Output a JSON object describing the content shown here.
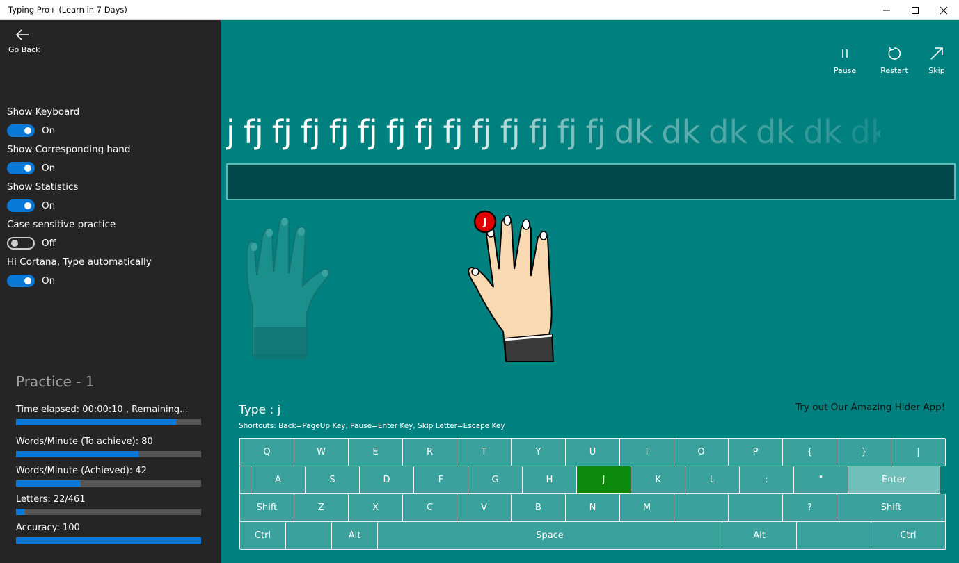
{
  "window": {
    "title": "Typing Pro+ (Learn in 7 Days)"
  },
  "sidebar": {
    "back_label": "Go Back",
    "settings": [
      {
        "label": "Show Keyboard",
        "on": true,
        "state": "On"
      },
      {
        "label": "Show Corresponding hand",
        "on": true,
        "state": "On"
      },
      {
        "label": "Show Statistics",
        "on": true,
        "state": "On"
      },
      {
        "label": "Case sensitive practice",
        "on": false,
        "state": "Off"
      },
      {
        "label": "Hi Cortana, Type automatically",
        "on": true,
        "state": "On"
      }
    ],
    "practice_title": "Practice - 1",
    "stats": [
      {
        "label": "Time elapsed: 00:00:10 , Remaining...",
        "progress": 0.87
      },
      {
        "label": "Words/Minute (To achieve): 80",
        "progress": 0.66
      },
      {
        "label": "Words/Minute (Achieved): 42",
        "progress": 0.35
      },
      {
        "label": "Letters: 22/461",
        "progress": 0.05
      },
      {
        "label": "Accuracy: 100",
        "progress": 1.0
      }
    ]
  },
  "actions": {
    "pause": "Pause",
    "restart": "Restart",
    "skip": "Skip"
  },
  "practice": {
    "words": [
      "j",
      "fj",
      "fj",
      "fj",
      "fj",
      "fj",
      "fj",
      "fj",
      "fj",
      "fj",
      "fj",
      "fj",
      "fj",
      "fj",
      "dk",
      "dk",
      "dk",
      "dk",
      "dk",
      "dk"
    ],
    "opacity": [
      1,
      1,
      1,
      1,
      1,
      1,
      1,
      1,
      0.9,
      0.8,
      0.7,
      0.6,
      0.5,
      0.45,
      0.4,
      0.35,
      0.3,
      0.25,
      0.2,
      0.12
    ]
  },
  "hand": {
    "finger_letter": "J"
  },
  "type_label": "Type : j",
  "shortcuts": "Shortcuts:  Back=PageUp Key,  Pause=Enter Key,  Skip Letter=Escape Key",
  "promo": "Try out Our Amazing Hider App!",
  "keyboard": {
    "active_key": "J",
    "rows": [
      [
        {
          "k": "Q",
          "w": 78
        },
        {
          "k": "W",
          "w": 78
        },
        {
          "k": "E",
          "w": 78
        },
        {
          "k": "R",
          "w": 78
        },
        {
          "k": "T",
          "w": 78
        },
        {
          "k": "Y",
          "w": 78
        },
        {
          "k": "U",
          "w": 78
        },
        {
          "k": "I",
          "w": 78
        },
        {
          "k": "O",
          "w": 78
        },
        {
          "k": "P",
          "w": 78
        },
        {
          "k": "{",
          "w": 78
        },
        {
          "k": "}",
          "w": 78
        },
        {
          "k": "|",
          "w": 78
        }
      ],
      [
        {
          "k": "",
          "w": 16
        },
        {
          "k": "A",
          "w": 78
        },
        {
          "k": "S",
          "w": 78
        },
        {
          "k": "D",
          "w": 78
        },
        {
          "k": "F",
          "w": 78
        },
        {
          "k": "G",
          "w": 78
        },
        {
          "k": "H",
          "w": 78
        },
        {
          "k": "J",
          "w": 78
        },
        {
          "k": "K",
          "w": 78
        },
        {
          "k": "L",
          "w": 78
        },
        {
          "k": ":",
          "w": 78
        },
        {
          "k": "\"",
          "w": 78
        },
        {
          "k": "Enter",
          "w": 132
        }
      ],
      [
        {
          "k": "Shift",
          "w": 78
        },
        {
          "k": "Z",
          "w": 78
        },
        {
          "k": "X",
          "w": 78
        },
        {
          "k": "C",
          "w": 78
        },
        {
          "k": "V",
          "w": 78
        },
        {
          "k": "B",
          "w": 78
        },
        {
          "k": "N",
          "w": 78
        },
        {
          "k": "M",
          "w": 78
        },
        {
          "k": "",
          "w": 78
        },
        {
          "k": "",
          "w": 78
        },
        {
          "k": "?",
          "w": 78
        },
        {
          "k": "Shift",
          "w": 156
        }
      ],
      [
        {
          "k": "Ctrl",
          "w": 66
        },
        {
          "k": "",
          "w": 66
        },
        {
          "k": "Alt",
          "w": 66
        },
        {
          "k": "Space",
          "w": 495
        },
        {
          "k": "Alt",
          "w": 107
        },
        {
          "k": "",
          "w": 107
        },
        {
          "k": "Ctrl",
          "w": 107
        }
      ]
    ]
  },
  "colors": {
    "sidebar_bg": "#252526",
    "main_bg": "#00807e",
    "accent": "#0a78d7",
    "active_key": "#0c8a0c"
  }
}
